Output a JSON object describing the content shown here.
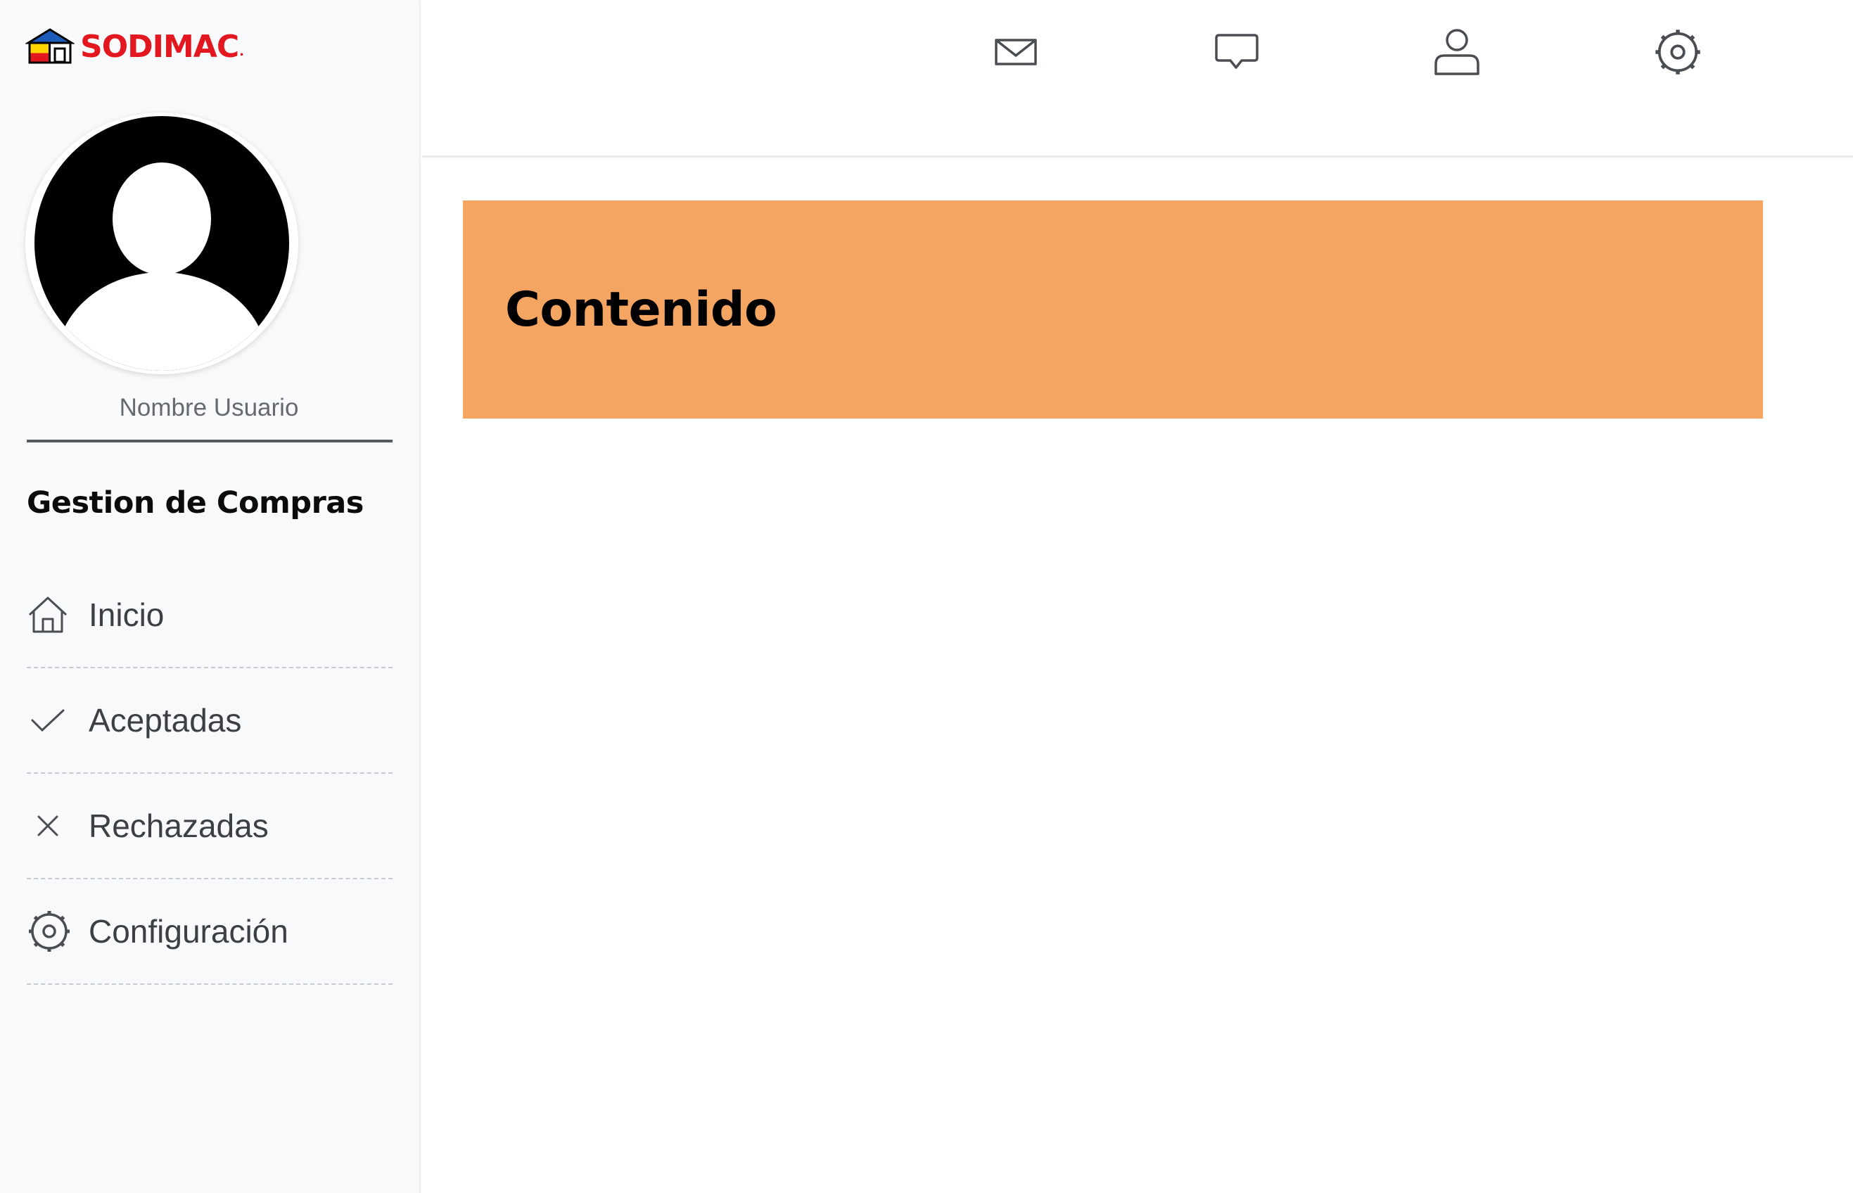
{
  "brand": {
    "name": "SODIMAC",
    "registered_mark": ".",
    "color": "#e2171f"
  },
  "sidebar": {
    "user": {
      "avatar_icon": "user-avatar-placeholder",
      "name": "Nombre Usuario"
    },
    "section_title": "Gestion de Compras",
    "items": [
      {
        "label": "Inicio",
        "icon": "home-icon"
      },
      {
        "label": "Aceptadas",
        "icon": "check-icon"
      },
      {
        "label": "Rechazadas",
        "icon": "close-icon"
      },
      {
        "label": "Configuración",
        "icon": "gear-icon"
      }
    ]
  },
  "topbar": {
    "icons": [
      "mail-icon",
      "chat-icon",
      "user-icon",
      "settings-icon"
    ]
  },
  "main": {
    "banner_title": "Contenido",
    "banner_color": "#f4a562"
  }
}
